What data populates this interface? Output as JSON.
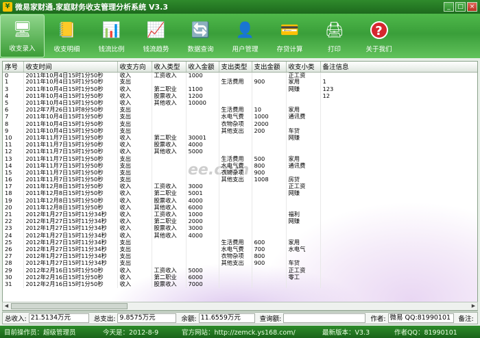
{
  "window": {
    "title": "微易家财通.家庭财务收支管理分析系统  V3.3",
    "minimize": "_",
    "maximize": "□",
    "close": "×"
  },
  "toolbar": [
    {
      "label": "收支录入",
      "icon": "monitor-icon",
      "glyph": "🖥"
    },
    {
      "label": "收支明细",
      "icon": "notebook-icon",
      "glyph": "📒"
    },
    {
      "label": "钱流比例",
      "icon": "pie-chart-icon",
      "glyph": "📊"
    },
    {
      "label": "钱流趋势",
      "icon": "trend-chart-icon",
      "glyph": "📈"
    },
    {
      "label": "数据查询",
      "icon": "data-query-icon",
      "glyph": "🔄"
    },
    {
      "label": "用户管理",
      "icon": "user-icon",
      "glyph": "👤"
    },
    {
      "label": "存贷计算",
      "icon": "card-icon",
      "glyph": "💳"
    },
    {
      "label": "打印",
      "icon": "printer-icon",
      "glyph": "🖨"
    },
    {
      "label": "关于我们",
      "icon": "help-icon",
      "glyph": "?"
    }
  ],
  "columns": [
    "序号",
    "收支时间",
    "收支方向",
    "收入类型",
    "收入金额",
    "支出类型",
    "支出金额",
    "收支小类",
    "备注信息"
  ],
  "rows": [
    [
      "0",
      "2011年10月4日15时1分50秒",
      "收入",
      "工资收入",
      "1000",
      "",
      "",
      "正工资",
      ""
    ],
    [
      "1",
      "2011年10月4日15时1分50秒",
      "支出",
      "",
      "",
      "生活费用",
      "900",
      "家用",
      "1"
    ],
    [
      "3",
      "2011年10月4日15时1分50秒",
      "收入",
      "第二职业",
      "1100",
      "",
      "",
      "网赚",
      "123"
    ],
    [
      "4",
      "2011年10月4日15时1分50秒",
      "收入",
      "股票收入",
      "1200",
      "",
      "",
      "",
      "12"
    ],
    [
      "5",
      "2011年10月4日15时1分50秒",
      "收入",
      "其他收入",
      "10000",
      "",
      "",
      "",
      ""
    ],
    [
      "6",
      "2012年7月26日11时8分50秒",
      "支出",
      "",
      "",
      "生活费用",
      "10",
      "家用",
      ""
    ],
    [
      "7",
      "2011年10月4日15时1分50秒",
      "支出",
      "",
      "",
      "水电气费",
      "1000",
      "通讯费",
      ""
    ],
    [
      "8",
      "2011年10月4日15时1分50秒",
      "支出",
      "",
      "",
      "衣物杂项",
      "2000",
      "",
      ""
    ],
    [
      "9",
      "2011年10月4日15时1分50秒",
      "支出",
      "",
      "",
      "其他支出",
      "200",
      "车贷",
      ""
    ],
    [
      "10",
      "2011年11月7日15时1分50秒",
      "收入",
      "第二职业",
      "30001",
      "",
      "",
      "网赚",
      ""
    ],
    [
      "11",
      "2011年11月7日15时1分50秒",
      "收入",
      "股票收入",
      "4000",
      "",
      "",
      "",
      ""
    ],
    [
      "12",
      "2011年11月7日15时1分50秒",
      "收入",
      "其他收入",
      "5000",
      "",
      "",
      "",
      ""
    ],
    [
      "13",
      "2011年11月7日15时1分50秒",
      "支出",
      "",
      "",
      "生活费用",
      "500",
      "家用",
      ""
    ],
    [
      "14",
      "2011年11月7日15时1分50秒",
      "支出",
      "",
      "",
      "水电气费",
      "800",
      "通讯费",
      ""
    ],
    [
      "15",
      "2011年11月7日15时1分50秒",
      "支出",
      "",
      "",
      "衣物杂项",
      "900",
      "",
      ""
    ],
    [
      "16",
      "2011年11月7日15时1分50秒",
      "支出",
      "",
      "",
      "其他支出",
      "1008",
      "房贷",
      ""
    ],
    [
      "17",
      "2011年12月8日15时1分50秒",
      "收入",
      "工资收入",
      "3000",
      "",
      "",
      "正工资",
      ""
    ],
    [
      "18",
      "2011年12月8日15时1分50秒",
      "收入",
      "第二职业",
      "5001",
      "",
      "",
      "网赚",
      ""
    ],
    [
      "19",
      "2011年12月8日15时1分50秒",
      "收入",
      "股票收入",
      "4000",
      "",
      "",
      "",
      ""
    ],
    [
      "20",
      "2011年12月8日15时1分50秒",
      "收入",
      "其他收入",
      "6000",
      "",
      "",
      "",
      ""
    ],
    [
      "21",
      "2012年1月27日15时11分34秒",
      "收入",
      "工资收入",
      "1000",
      "",
      "",
      "福利",
      ""
    ],
    [
      "22",
      "2012年1月27日15时11分34秒",
      "收入",
      "第二职业",
      "2000",
      "",
      "",
      "网赚",
      ""
    ],
    [
      "23",
      "2012年1月27日15时11分34秒",
      "收入",
      "股票收入",
      "3000",
      "",
      "",
      "",
      ""
    ],
    [
      "24",
      "2012年1月27日15时11分34秒",
      "收入",
      "其他收入",
      "4000",
      "",
      "",
      "",
      ""
    ],
    [
      "25",
      "2012年1月27日15时11分34秒",
      "支出",
      "",
      "",
      "生活费用",
      "600",
      "家用",
      ""
    ],
    [
      "26",
      "2012年1月27日15时11分34秒",
      "支出",
      "",
      "",
      "水电气费",
      "700",
      "水电气",
      ""
    ],
    [
      "27",
      "2012年1月27日15时11分34秒",
      "支出",
      "",
      "",
      "衣物杂项",
      "800",
      "",
      ""
    ],
    [
      "28",
      "2012年1月27日15时11分34秒",
      "支出",
      "",
      "",
      "其他支出",
      "900",
      "车贷",
      ""
    ],
    [
      "29",
      "2012年2月16日15时1分50秒",
      "收入",
      "工资收入",
      "5000",
      "",
      "",
      "正工资",
      ""
    ],
    [
      "30",
      "2012年2月16日15时1分50秒",
      "收入",
      "第二职业",
      "6000",
      "",
      "",
      "零工",
      ""
    ],
    [
      "31",
      "2012年2月16日15时1分50秒",
      "收入",
      "股票收入",
      "7000",
      "",
      "",
      "",
      ""
    ]
  ],
  "watermark": "ee.com",
  "summary": {
    "income_label": "总收入:",
    "income_value": "21.5134万元",
    "expense_label": "总支出:",
    "expense_value": "9.8575万元",
    "balance_label": "余额:",
    "balance_value": "11.6559万元",
    "query_label": "查询额:",
    "query_value": "",
    "author_label": "作者:",
    "author_value": "微易 QQ:81990101",
    "note_label": "备注:"
  },
  "status": {
    "operator": "目前操作员：超级管理员",
    "today": "今天是：2012-8-9",
    "website": "官方网站：http://zemck.ys168.com/",
    "version": "最新版本：V3.3",
    "qq": "作者QQ：81990101"
  }
}
